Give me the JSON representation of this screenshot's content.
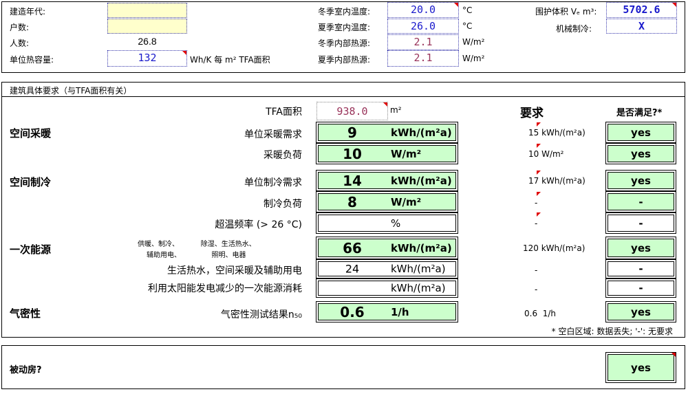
{
  "top": {
    "build_year_label": "建造年代:",
    "households_label": "户数:",
    "occupants_label": "人数:",
    "occupants_value": "26.8",
    "heat_capacity_label": "单位热容量:",
    "heat_capacity_value": "132",
    "heat_capacity_unit": "Wh/K 每 m² TFA面积",
    "winter_temp_label": "冬季室内温度:",
    "winter_temp_value": "20.0",
    "summer_temp_label": "夏季室内温度:",
    "summer_temp_value": "26.0",
    "winter_gain_label": "冬季内部热源:",
    "winter_gain_value": "2.1",
    "summer_gain_label": "夏季内部热源:",
    "summer_gain_value": "2.1",
    "celsius": "°C",
    "wm2": "W/m²",
    "volume_label": "围护体积 Vₑ m³:",
    "volume_value": "5702.6",
    "mech_cool_label": "机械制冷:",
    "mech_cool_value": "X"
  },
  "section": {
    "title": "建筑具体要求（与TFA面积有关）",
    "tfa_label": "TFA面积",
    "tfa_value": "938.0",
    "tfa_unit": "m²",
    "req_header": "要求",
    "meets_header": "是否满足?*",
    "heating": "空间采暖",
    "cooling": "空间制冷",
    "primary": "一次能源",
    "airtight": "气密性",
    "footnote": "* 空白区域: 数据丢失; '-': 无要求"
  },
  "rows": {
    "heat_demand": {
      "label": "单位采暖需求",
      "value": "9",
      "unit": "kWh/(m²a)",
      "req": "15 kWh/(m²a)",
      "ok": "yes"
    },
    "heat_load": {
      "label": "采暖负荷",
      "value": "10",
      "unit": "W/m²",
      "req": "10 W/m²",
      "ok": "yes"
    },
    "cool_demand": {
      "label": "单位制冷需求",
      "value": "14",
      "unit": "kWh/(m²a)",
      "req": "17 kWh/(m²a)",
      "ok": "yes"
    },
    "cool_load": {
      "label": "制冷负荷",
      "value": "8",
      "unit": "W/m²",
      "req": "-",
      "ok": "-"
    },
    "overheat": {
      "label": "超温频率 (> 26 °C)",
      "value": "",
      "unit": "%",
      "req": "-",
      "ok": "-"
    },
    "pe_total": {
      "label_line1": "供暖、制冷、          除湿、生活热水、",
      "label_line2": "辅助用电、              照明、电器",
      "value": "66",
      "unit": "kWh/(m²a)",
      "req": "120 kWh/(m²a)",
      "ok": "yes"
    },
    "pe_dhw": {
      "label": "生活热水，空间采暖及辅助用电",
      "value": "24",
      "unit": "kWh/(m²a)",
      "req": "-",
      "ok": "-"
    },
    "pe_solar": {
      "label": "利用太阳能发电减少的一次能源消耗",
      "value": "",
      "unit": "kWh/(m²a)",
      "req": "-",
      "ok": "-"
    },
    "n50": {
      "label": "气密性测试结果n₅₀",
      "value": "0.6",
      "unit": "1/h",
      "req": "0.6  1/h",
      "ok": "yes"
    }
  },
  "bottom": {
    "passive_label": "被动房?",
    "passive_value": "yes"
  }
}
